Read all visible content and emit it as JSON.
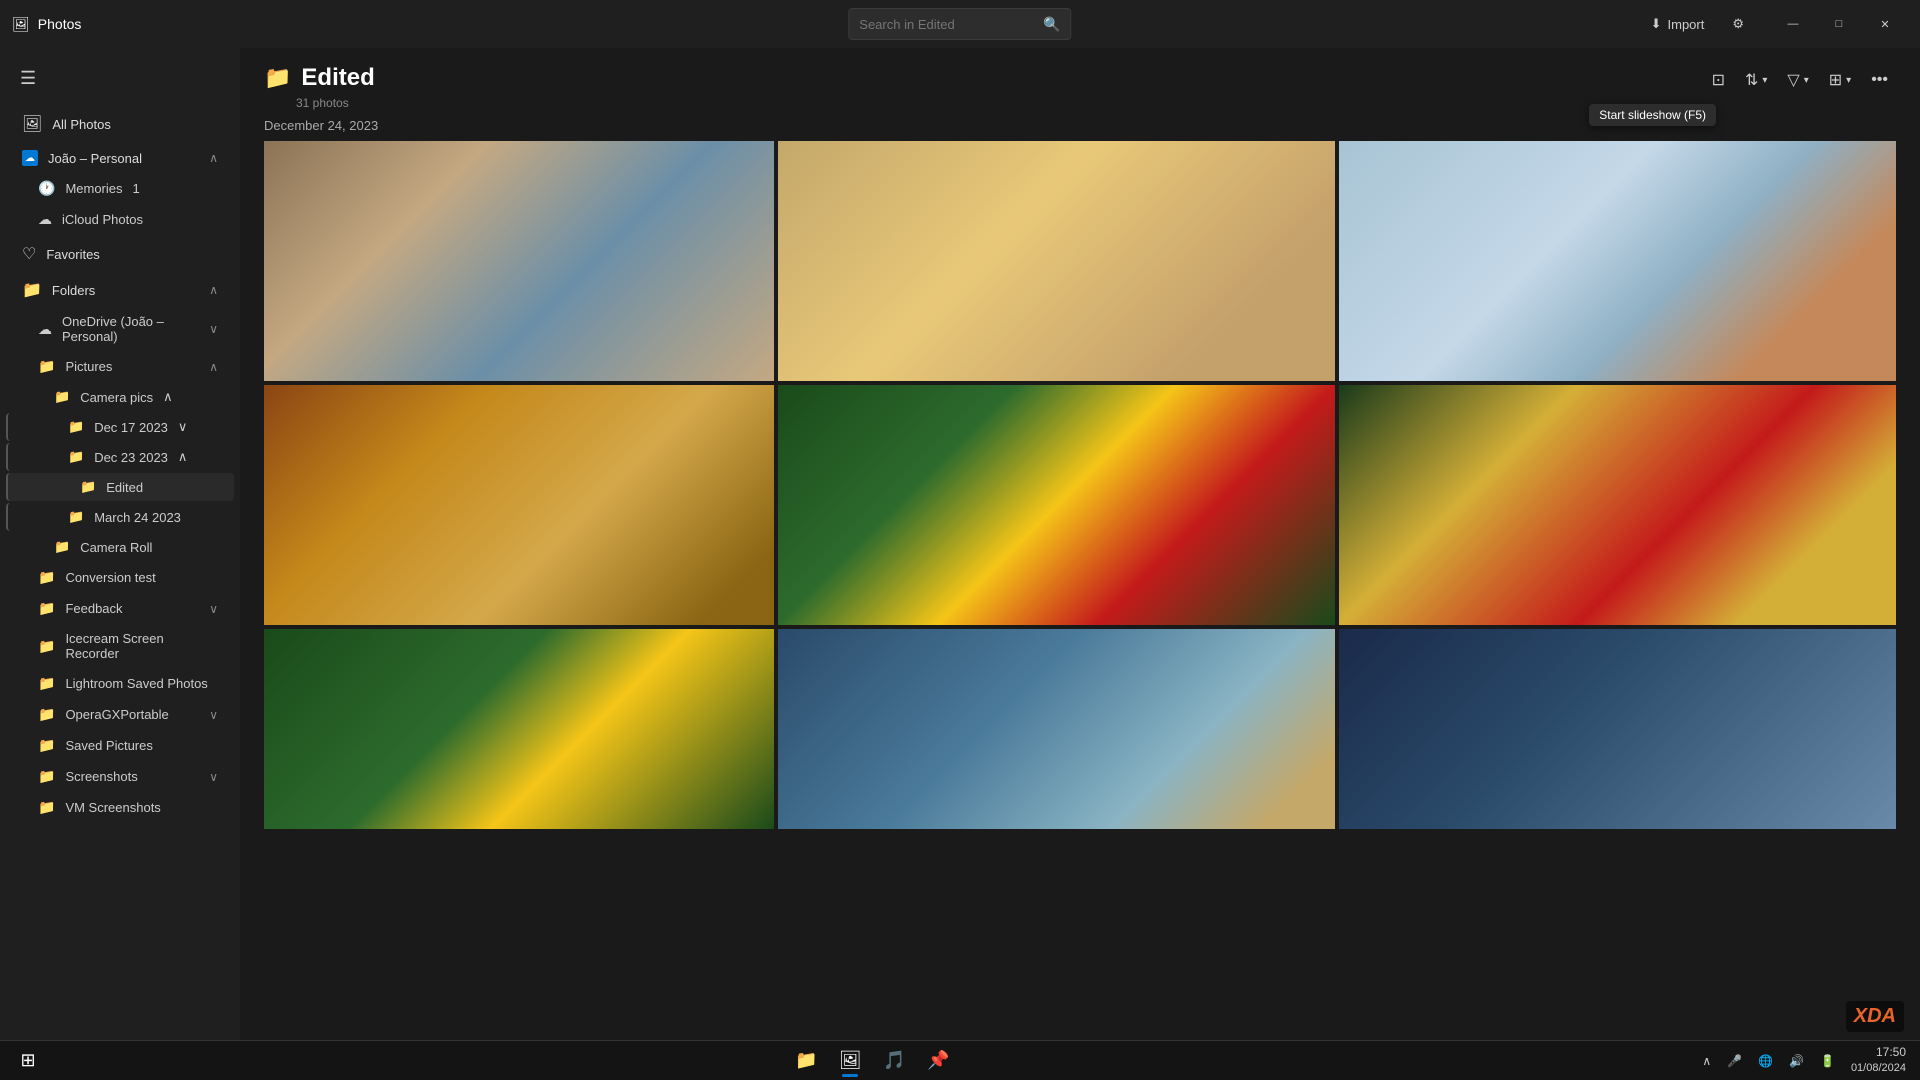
{
  "app": {
    "name": "Photos",
    "logo": "🖼"
  },
  "search": {
    "placeholder": "Search in Edited"
  },
  "titlebar": {
    "import_label": "Import",
    "settings_label": "⚙"
  },
  "window_controls": {
    "minimize": "—",
    "maximize": "□",
    "close": "✕"
  },
  "sidebar": {
    "hamburger": "☰",
    "all_photos": "All Photos",
    "sections": [
      {
        "id": "joao-personal",
        "label": "João – Personal",
        "icon": "☁",
        "expanded": true,
        "sub_items": [
          {
            "id": "memories",
            "label": "Memories",
            "icon": "🕐",
            "badge": "1"
          },
          {
            "id": "icloud",
            "label": "iCloud Photos",
            "icon": "☁"
          }
        ]
      }
    ],
    "favorites": "Favorites",
    "favorites_icon": "♡",
    "folders_label": "Folders",
    "folders_icon": "📁",
    "folders_expanded": true,
    "onedrive_label": "OneDrive (João – Personal)",
    "pictures_label": "Pictures",
    "pictures_expanded": true,
    "camera_pics_label": "Camera pics",
    "camera_pics_expanded": true,
    "dec17": "Dec 17 2023",
    "dec23": "Dec 23 2023",
    "dec23_expanded": true,
    "edited": "Edited",
    "march24": "March 24 2023",
    "camera_roll": "Camera Roll",
    "conversion_test": "Conversion test",
    "feedback": "Feedback",
    "icecream": "Icecream Screen Recorder",
    "lightroom": "Lightroom Saved Photos",
    "operagx": "OperaGXPortable",
    "saved_pictures": "Saved Pictures",
    "screenshots": "Screenshots",
    "vm_screenshots": "VM Screenshots"
  },
  "content": {
    "folder_icon": "📁",
    "title": "Edited",
    "photo_count": "31 photos",
    "date_section": "December 24, 2023"
  },
  "toolbar": {
    "slideshow_label": "Start slideshow (F5)",
    "sort_icon": "⇅",
    "filter_icon": "▽",
    "view_icon": "⊞",
    "more_icon": "•••"
  },
  "taskbar": {
    "start_icon": "⊞",
    "apps": [
      {
        "id": "explorer",
        "icon": "📁",
        "active": false
      },
      {
        "id": "photos",
        "icon": "🖼",
        "active": true
      },
      {
        "id": "music",
        "icon": "🎵",
        "active": false
      },
      {
        "id": "app4",
        "icon": "📌",
        "active": false
      }
    ],
    "time": "17:50",
    "date": "01/08/2024"
  }
}
